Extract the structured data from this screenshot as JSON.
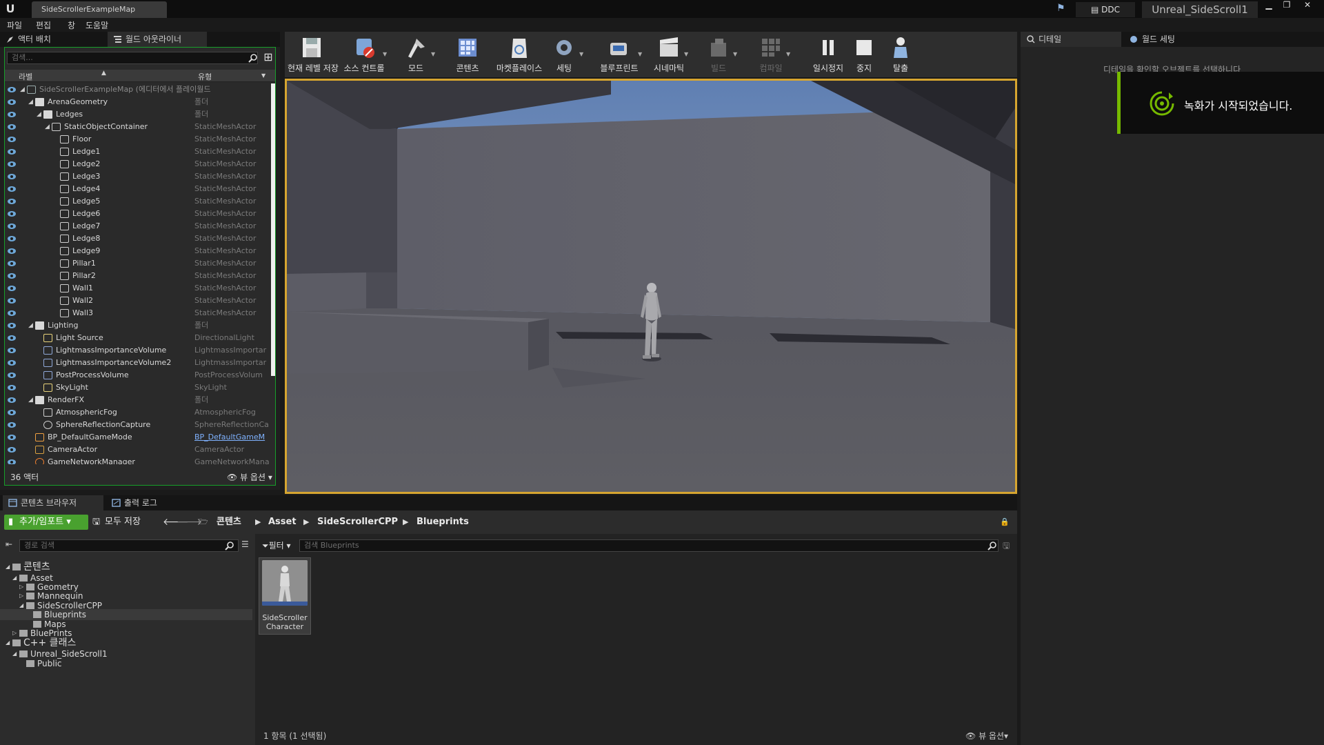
{
  "window": {
    "map_tab": "SideScrollerExampleMap",
    "ddc": "DDC",
    "project_name": "Unreal_SideScroll1"
  },
  "menu": [
    "파일",
    "편집",
    "창",
    "도움말"
  ],
  "left_tabs": {
    "place_actors": "액터 배치",
    "world_outliner": "월드 아웃라이너"
  },
  "outliner": {
    "search_placeholder": "검색...",
    "col_label": "라벨",
    "col_type": "유형",
    "rows": [
      {
        "label": "SideScrollerExampleMap (에디터에서 플레이월드",
        "type": "",
        "indent": 0,
        "arrow": "◢",
        "icon": "map",
        "dim": true
      },
      {
        "label": "ArenaGeometry",
        "type": "폴더",
        "indent": 1,
        "arrow": "◢",
        "icon": "folder"
      },
      {
        "label": "Ledges",
        "type": "폴더",
        "indent": 2,
        "arrow": "◢",
        "icon": "folder"
      },
      {
        "label": "StaticObjectContainer",
        "type": "StaticMeshActor",
        "indent": 3,
        "arrow": "◢",
        "icon": "mesh"
      },
      {
        "label": "Floor",
        "type": "StaticMeshActor",
        "indent": 4,
        "icon": "mesh"
      },
      {
        "label": "Ledge1",
        "type": "StaticMeshActor",
        "indent": 4,
        "icon": "mesh"
      },
      {
        "label": "Ledge2",
        "type": "StaticMeshActor",
        "indent": 4,
        "icon": "mesh"
      },
      {
        "label": "Ledge3",
        "type": "StaticMeshActor",
        "indent": 4,
        "icon": "mesh"
      },
      {
        "label": "Ledge4",
        "type": "StaticMeshActor",
        "indent": 4,
        "icon": "mesh"
      },
      {
        "label": "Ledge5",
        "type": "StaticMeshActor",
        "indent": 4,
        "icon": "mesh"
      },
      {
        "label": "Ledge6",
        "type": "StaticMeshActor",
        "indent": 4,
        "icon": "mesh"
      },
      {
        "label": "Ledge7",
        "type": "StaticMeshActor",
        "indent": 4,
        "icon": "mesh"
      },
      {
        "label": "Ledge8",
        "type": "StaticMeshActor",
        "indent": 4,
        "icon": "mesh"
      },
      {
        "label": "Ledge9",
        "type": "StaticMeshActor",
        "indent": 4,
        "icon": "mesh"
      },
      {
        "label": "Pillar1",
        "type": "StaticMeshActor",
        "indent": 4,
        "icon": "mesh"
      },
      {
        "label": "Pillar2",
        "type": "StaticMeshActor",
        "indent": 4,
        "icon": "mesh"
      },
      {
        "label": "Wall1",
        "type": "StaticMeshActor",
        "indent": 4,
        "icon": "mesh"
      },
      {
        "label": "Wall2",
        "type": "StaticMeshActor",
        "indent": 4,
        "icon": "mesh"
      },
      {
        "label": "Wall3",
        "type": "StaticMeshActor",
        "indent": 4,
        "icon": "mesh"
      },
      {
        "label": "Lighting",
        "type": "폴더",
        "indent": 1,
        "arrow": "◢",
        "icon": "folder"
      },
      {
        "label": "Light Source",
        "type": "DirectionalLight",
        "indent": 2,
        "icon": "light"
      },
      {
        "label": "LightmassImportanceVolume",
        "type": "LightmassImportar",
        "indent": 2,
        "icon": "volume"
      },
      {
        "label": "LightmassImportanceVolume2",
        "type": "LightmassImportar",
        "indent": 2,
        "icon": "volume"
      },
      {
        "label": "PostProcessVolume",
        "type": "PostProcessVolum",
        "indent": 2,
        "icon": "volume"
      },
      {
        "label": "SkyLight",
        "type": "SkyLight",
        "indent": 2,
        "icon": "light"
      },
      {
        "label": "RenderFX",
        "type": "폴더",
        "indent": 1,
        "arrow": "◢",
        "icon": "folder"
      },
      {
        "label": "AtmosphericFog",
        "type": "AtmosphericFog",
        "indent": 2,
        "icon": "fog"
      },
      {
        "label": "SphereReflectionCapture",
        "type": "SphereReflectionCa",
        "indent": 2,
        "icon": "sphere"
      },
      {
        "label": "BP_DefaultGameMode",
        "type": "BP_DefaultGameM",
        "indent": 1,
        "icon": "gamemode",
        "link": true,
        "orange": true
      },
      {
        "label": "CameraActor",
        "type": "CameraActor",
        "indent": 1,
        "icon": "camera",
        "orange": true
      },
      {
        "label": "GameNetworkManager",
        "type": "GameNetworkMana",
        "indent": 1,
        "icon": "network",
        "orange": true
      }
    ],
    "actor_count": "36 액터",
    "view_options": "뷰 옵션"
  },
  "toolbar": [
    {
      "label": "현재 레벨 저장",
      "icon": "save-icon",
      "dropdown": false
    },
    {
      "label": "소스 컨트롤",
      "icon": "source-control-icon",
      "dropdown": true
    },
    {
      "label": "모드",
      "icon": "modes-icon",
      "dropdown": true
    },
    {
      "label": "콘텐츠",
      "icon": "content-icon",
      "dropdown": false
    },
    {
      "label": "마켓플레이스",
      "icon": "marketplace-icon",
      "dropdown": false
    },
    {
      "label": "세팅",
      "icon": "settings-icon",
      "dropdown": true
    },
    {
      "label": "블루프린트",
      "icon": "blueprint-icon",
      "dropdown": true
    },
    {
      "label": "시네마틱",
      "icon": "cinematics-icon",
      "dropdown": true
    },
    {
      "label": "빌드",
      "icon": "build-icon",
      "dropdown": true,
      "disabled": true
    },
    {
      "label": "컴파일",
      "icon": "compile-icon",
      "dropdown": true,
      "disabled": true
    },
    {
      "label": "일시정지",
      "icon": "pause-icon",
      "dropdown": false
    },
    {
      "label": "중지",
      "icon": "stop-icon",
      "dropdown": false
    },
    {
      "label": "탈출",
      "icon": "eject-icon",
      "dropdown": false
    }
  ],
  "right_tabs": {
    "details": "디테일",
    "world_settings": "월드 세팅"
  },
  "details_message": "디테일을 확인할 오브젝트를 선택하니다",
  "toast": "녹화가 시작되었습니다.",
  "bottom_tabs": {
    "content_browser": "콘텐츠 브라우저",
    "output_log": "출력 로그"
  },
  "content_browser": {
    "add_import": "추가/임포트",
    "save_all": "모두 저장",
    "breadcrumbs": [
      "콘텐츠",
      "Asset",
      "SideScrollerCPP",
      "Blueprints"
    ],
    "path_search_placeholder": "경로 검색",
    "filter": "필터",
    "search_placeholder": "검색 Blueprints",
    "tree": [
      {
        "label": "콘텐츠",
        "indent": 0,
        "arrow": "◢",
        "big": true
      },
      {
        "label": "Asset",
        "indent": 1,
        "arrow": "◢"
      },
      {
        "label": "Geometry",
        "indent": 2,
        "arrow": "▷"
      },
      {
        "label": "Mannequin",
        "indent": 2,
        "arrow": "▷"
      },
      {
        "label": "SideScrollerCPP",
        "indent": 2,
        "arrow": "◢"
      },
      {
        "label": "Blueprints",
        "indent": 3,
        "selected": true
      },
      {
        "label": "Maps",
        "indent": 3
      },
      {
        "label": "BluePrints",
        "indent": 1,
        "arrow": "▷"
      },
      {
        "label": "C++ 클래스",
        "indent": 0,
        "arrow": "◢",
        "big": true
      },
      {
        "label": "Unreal_SideScroll1",
        "indent": 1,
        "arrow": "◢"
      },
      {
        "label": "Public",
        "indent": 2
      }
    ],
    "asset_tile": "SideScroller Character",
    "item_count": "1 항목 (1 선택됨)",
    "view_options": "뷰 옵션"
  },
  "colors": {
    "accent_green": "#49a12f",
    "viewport_border": "#d6a530",
    "nvidia_green": "#76b900",
    "link_blue": "#7fb2ff"
  }
}
